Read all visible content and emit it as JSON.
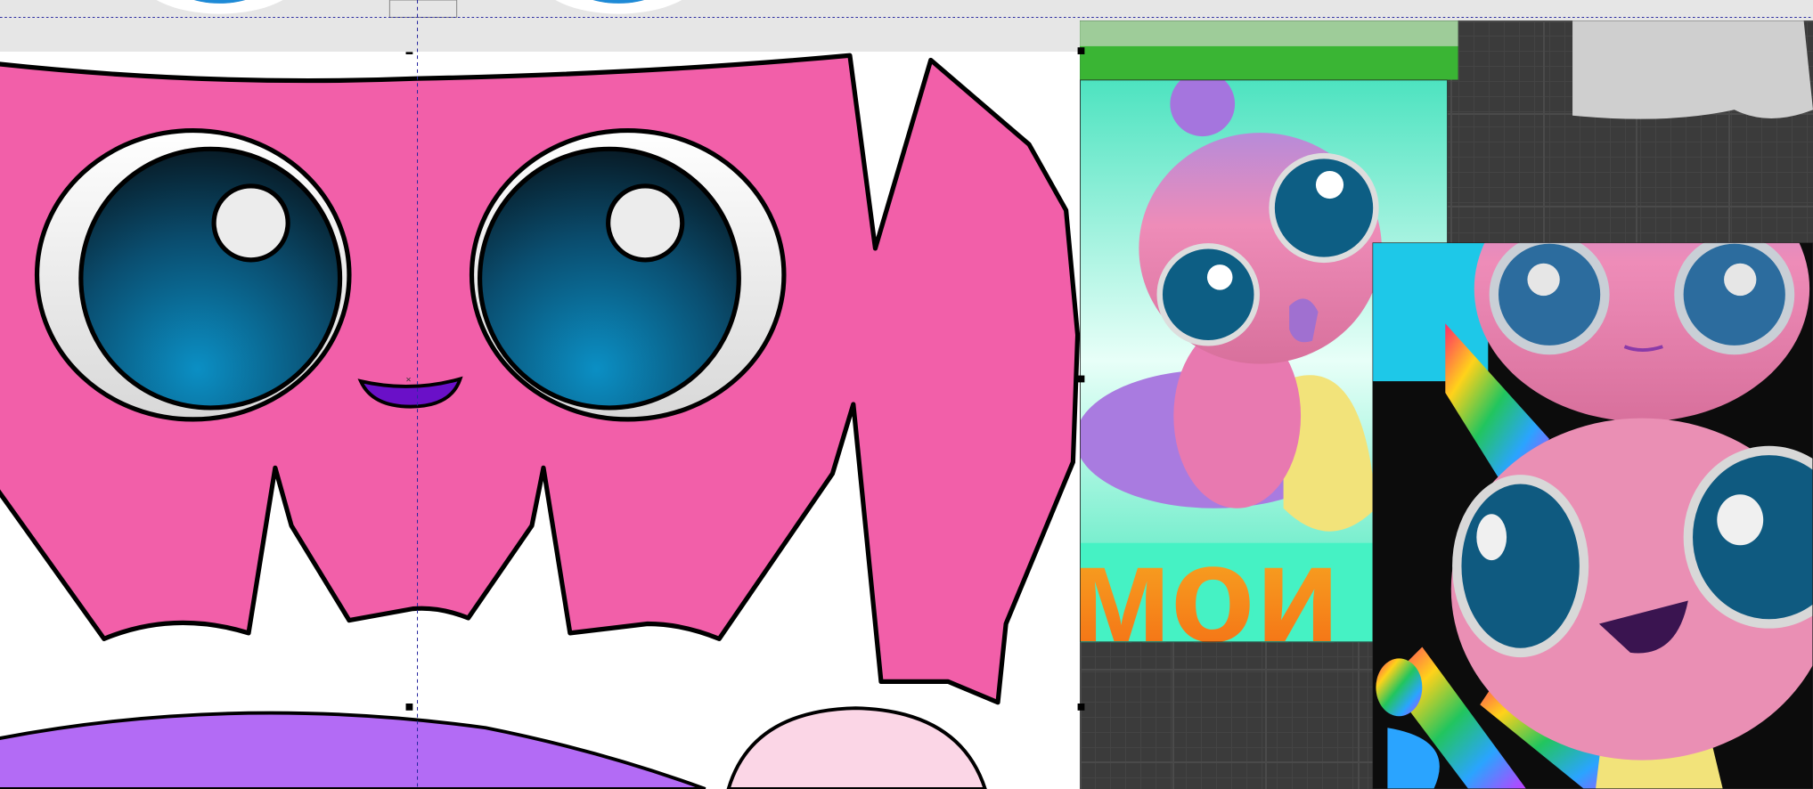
{
  "canvas": {
    "background_color": "#ffffff",
    "workspace_color": "#e6e6e6",
    "dark_grid_color": "#3b3b3b",
    "guide_color": "#2a2aa0"
  },
  "artwork": {
    "mask_color": "#f25fa9",
    "iris_color": "#0a5f86",
    "mouth_color": "#6a10c8",
    "poster_lettering": "мои"
  }
}
